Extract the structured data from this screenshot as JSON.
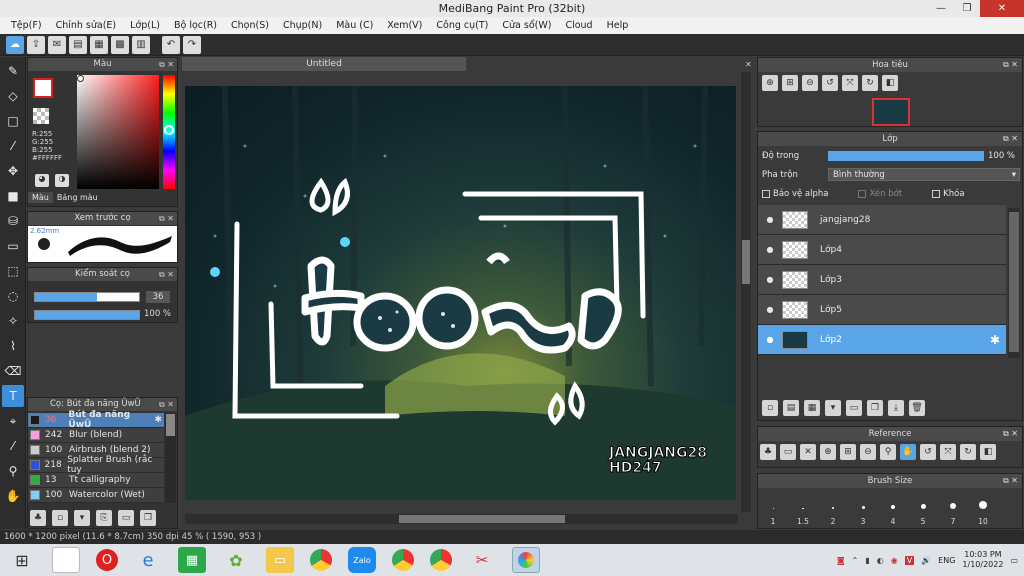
{
  "app": {
    "title": "MediBang Paint Pro (32bit)"
  },
  "menu": [
    "Tệp(F)",
    "Chỉnh sửa(E)",
    "Lớp(L)",
    "Bộ lọc(R)",
    "Chọn(S)",
    "Chụp(N)",
    "Màu (C)",
    "Xem(V)",
    "Công cụ(T)",
    "Cửa sổ(W)",
    "Cloud",
    "Help"
  ],
  "color_panel": {
    "title": "Màu",
    "r": "R:255",
    "g": "G:255",
    "b": "B:255",
    "hex": "#FFFFFF",
    "tab_color": "Màu",
    "tab_palette": "Bảng màu"
  },
  "brush_preview": {
    "title": "Xem trước cọ",
    "size": "2.62mm"
  },
  "brush_control": {
    "title": "Kiểm soát cọ",
    "size_value": "36",
    "opacity_value": "100 %",
    "size_fill": 0.6,
    "opacity_fill": 1.0
  },
  "brush_list": {
    "title": "Cọ: Bút đa năng ŨwŨ",
    "items": [
      {
        "value": "36",
        "name": "Bút đa năng ŨwŨ",
        "color": "#1a1a1a",
        "selected": true
      },
      {
        "value": "242",
        "name": "Blur (blend)",
        "color": "#f4a0e0",
        "selected": false
      },
      {
        "value": "100",
        "name": "Airbrush (blend 2)",
        "color": "#cccccc",
        "selected": false
      },
      {
        "value": "218",
        "name": "Splatter Brush (rắc tuy",
        "color": "#3050e0",
        "selected": false
      },
      {
        "value": "13",
        "name": "Tt calligraphy",
        "color": "#30b040",
        "selected": false
      },
      {
        "value": "100",
        "name": "Watercolor (Wet)",
        "color": "#80d0f0",
        "selected": false
      }
    ]
  },
  "document": {
    "tab": "Untitled",
    "watermark_line1": "JANGJANG28",
    "watermark_line2": "HD247"
  },
  "navigator": {
    "title": "Hoa tiêu"
  },
  "layer_panel": {
    "title": "Lớp",
    "opacity_label": "Độ trong",
    "opacity_value": "100 %",
    "opacity": 1.0,
    "blend_label": "Pha trộn",
    "blend_value": "Bình thường",
    "protect_alpha": "Bảo vệ alpha",
    "clipping": "Xén bớt",
    "lock": "Khóa",
    "layers": [
      {
        "name": "jangjang28",
        "selected": false
      },
      {
        "name": "Lớp4",
        "selected": false
      },
      {
        "name": "Lớp3",
        "selected": false
      },
      {
        "name": "Lớp5",
        "selected": false
      },
      {
        "name": "Lớp2",
        "selected": true
      }
    ]
  },
  "reference": {
    "title": "Reference"
  },
  "brush_size": {
    "title": "Brush Size",
    "sizes": [
      "1",
      "1.5",
      "2",
      "3",
      "4",
      "5",
      "7",
      "10"
    ]
  },
  "status": {
    "text": "1600 * 1200 pixel   (11.6 * 8.7cm)   350 dpi   45 %   ( 1590, 953 )"
  },
  "taskbar": {
    "lang": "ENG",
    "time": "10:03 PM",
    "date": "1/10/2022"
  }
}
